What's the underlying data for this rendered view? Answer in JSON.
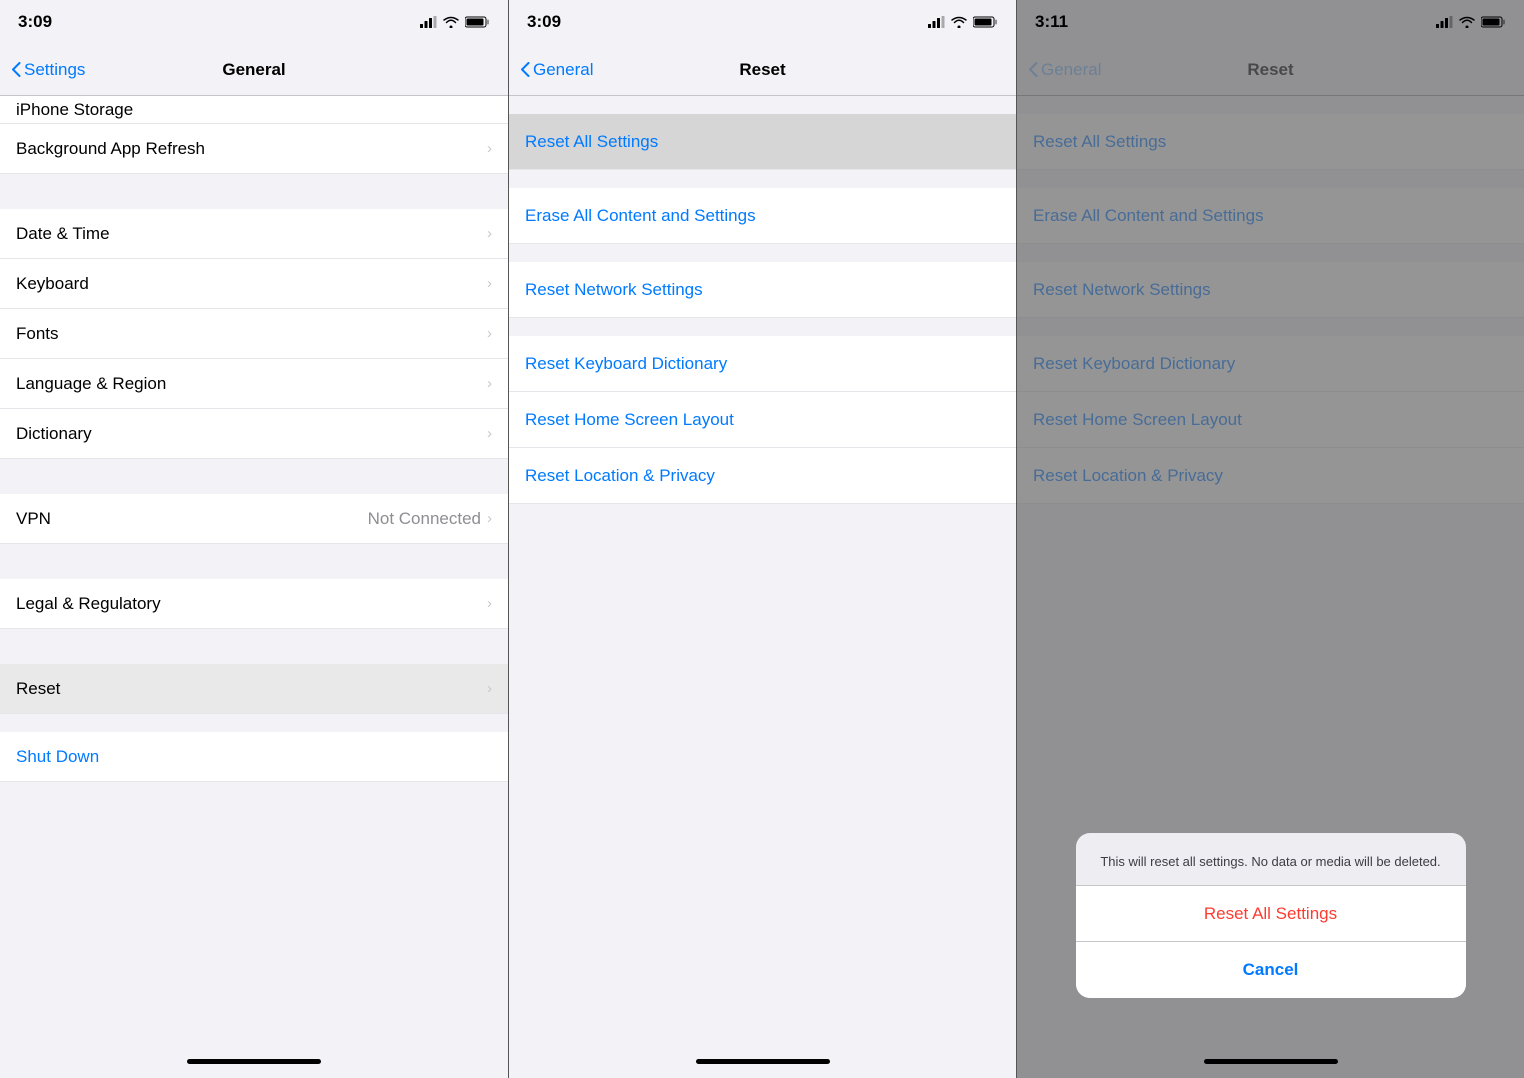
{
  "panels": {
    "left": {
      "statusBar": {
        "time": "3:09"
      },
      "navBar": {
        "back": "Settings",
        "title": "General"
      },
      "partialCell": "iPhone Storage",
      "sections": [
        {
          "cells": [
            {
              "label": "Background App Refresh",
              "value": "",
              "chevron": true
            }
          ]
        },
        {
          "cells": [
            {
              "label": "Date & Time",
              "value": "",
              "chevron": true
            },
            {
              "label": "Keyboard",
              "value": "",
              "chevron": true
            },
            {
              "label": "Fonts",
              "value": "",
              "chevron": true
            },
            {
              "label": "Language & Region",
              "value": "",
              "chevron": true
            },
            {
              "label": "Dictionary",
              "value": "",
              "chevron": true
            }
          ]
        },
        {
          "cells": [
            {
              "label": "VPN",
              "value": "Not Connected",
              "chevron": true
            }
          ]
        },
        {
          "cells": [
            {
              "label": "Legal & Regulatory",
              "value": "",
              "chevron": true
            }
          ]
        },
        {
          "cells": [
            {
              "label": "Reset",
              "value": "",
              "chevron": true,
              "highlighted": true
            }
          ]
        },
        {
          "cells": [
            {
              "label": "Shut Down",
              "value": "",
              "chevron": false,
              "blue": true
            }
          ]
        }
      ]
    },
    "middle": {
      "statusBar": {
        "time": "3:09"
      },
      "navBar": {
        "back": "General",
        "title": "Reset"
      },
      "resetItems": [
        {
          "label": "Reset All Settings",
          "highlighted": true
        },
        {
          "label": "Erase All Content and Settings",
          "highlighted": false
        },
        {
          "label": "Reset Network Settings",
          "highlighted": false
        },
        {
          "label": "Reset Keyboard Dictionary",
          "highlighted": false
        },
        {
          "label": "Reset Home Screen Layout",
          "highlighted": false
        },
        {
          "label": "Reset Location & Privacy",
          "highlighted": false
        }
      ]
    },
    "right": {
      "statusBar": {
        "time": "3:11"
      },
      "navBar": {
        "back": "General",
        "title": "Reset"
      },
      "resetItems": [
        {
          "label": "Reset All Settings"
        },
        {
          "label": "Erase All Content and Settings"
        },
        {
          "label": "Reset Network Settings"
        },
        {
          "label": "Reset Keyboard Dictionary"
        },
        {
          "label": "Reset Home Screen Layout"
        },
        {
          "label": "Reset Location & Privacy"
        }
      ],
      "alert": {
        "message": "This will reset all settings. No data or media will be deleted.",
        "confirmLabel": "Reset All Settings",
        "cancelLabel": "Cancel"
      }
    }
  }
}
